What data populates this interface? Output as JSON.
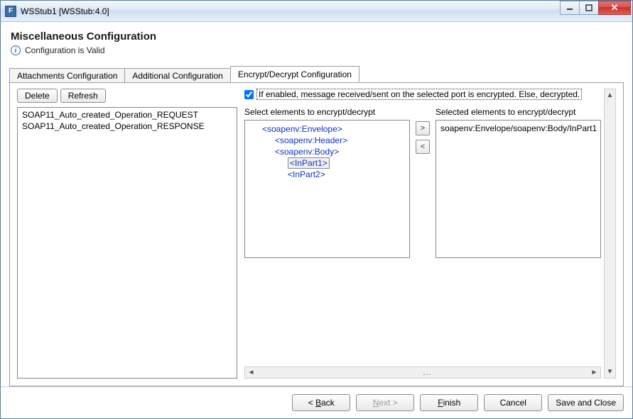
{
  "window": {
    "title": "WSStub1 [WSStub:4.0]",
    "app_icon_letter": "F"
  },
  "header": {
    "title": "Miscellaneous Configuration",
    "status_text": "Configuration is Valid"
  },
  "tabs": {
    "attachments": "Attachments Configuration",
    "additional": "Additional Configuration",
    "encrypt": "Encrypt/Decrypt Configuration"
  },
  "toolbar": {
    "delete": "Delete",
    "refresh": "Refresh"
  },
  "operation_list": {
    "items": [
      "SOAP11_Auto_created_Operation_REQUEST",
      "SOAP11_Auto_created_Operation_RESPONSE"
    ]
  },
  "encrypt_panel": {
    "enable_checkbox_checked": true,
    "enable_label": "If enabled, message received/sent on the selected port is encrypted. Else, decrypted.",
    "select_label": "Select elements to encrypt/decrypt",
    "selected_label": "Selected elements to encrypt/decrypt",
    "tree": {
      "n0": "<soapenv:Envelope>",
      "n1": "<soapenv:Header>",
      "n2": "<soapenv:Body>",
      "n3": "<InPart1>",
      "n4": "<InPart2>"
    },
    "move_right": ">",
    "move_left": "<",
    "selected_items": [
      "soapenv:Envelope/soapenv:Body/InPart1"
    ]
  },
  "footer": {
    "back_prefix": "< ",
    "back_mnemonic": "B",
    "back_rest": "ack",
    "next_mnemonic": "N",
    "next_rest": "ext >",
    "finish_mnemonic": "F",
    "finish_rest": "inish",
    "cancel": "Cancel",
    "save_close": "Save and Close"
  }
}
